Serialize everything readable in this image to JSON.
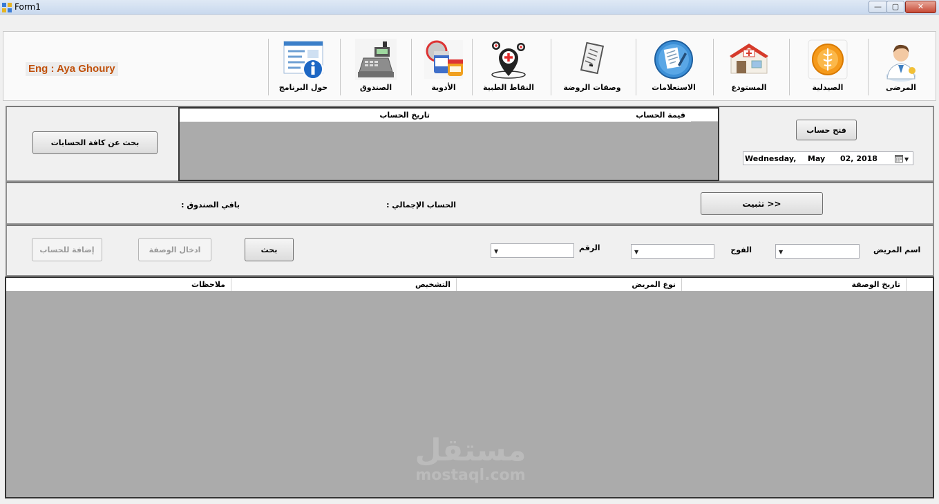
{
  "window": {
    "title": "Form1",
    "minimize_glyph": "—",
    "maximize_glyph": "▢",
    "close_glyph": "✕"
  },
  "header": {
    "author": "Eng : Aya Ghoury"
  },
  "toolbar": {
    "items": [
      {
        "label": "المرضى",
        "icon": "doctor-icon"
      },
      {
        "label": "الصيدلية",
        "icon": "pharmacy-icon"
      },
      {
        "label": "المستودع",
        "icon": "warehouse-icon"
      },
      {
        "label": "الاستعلامات",
        "icon": "inquiry-icon"
      },
      {
        "label": "وصفات الروضة",
        "icon": "prescription-icon"
      },
      {
        "label": "النقاط الطبية",
        "icon": "medical-points-icon"
      },
      {
        "label": "الأدوية",
        "icon": "medicine-icon"
      },
      {
        "label": "الصندوق",
        "icon": "cash-register-icon"
      },
      {
        "label": "حول البرنامج",
        "icon": "about-icon"
      }
    ]
  },
  "accounts": {
    "open_account_label": "فتح حساب",
    "date_picker": {
      "weekday": "Wednesday,",
      "month": "May",
      "day_year": "02, 2018"
    },
    "grid_columns": [
      "قيمة الحساب",
      "تاريخ الحساب"
    ],
    "search_all_label": "بحث عن كافة الحسابات"
  },
  "summary": {
    "confirm_label": "تثبيت >>",
    "total_label": "الحساب الإجمالي :",
    "balance_label": "باقي الصندوق :"
  },
  "search": {
    "patient_name_label": "اسم المريض",
    "group_label": "الفوج",
    "number_label": "الرقم",
    "search_button": "بحث",
    "enter_prescription_button": "ادخال الوصفة",
    "add_to_account_button": "إضافة للحساب"
  },
  "prescriptions_grid": {
    "columns": [
      "تاريخ الوصفة",
      "نوع المريض",
      "التشخيص",
      "ملاحظات"
    ]
  },
  "watermark": {
    "arabic": "مستقل",
    "latin": "mostaql.com"
  }
}
